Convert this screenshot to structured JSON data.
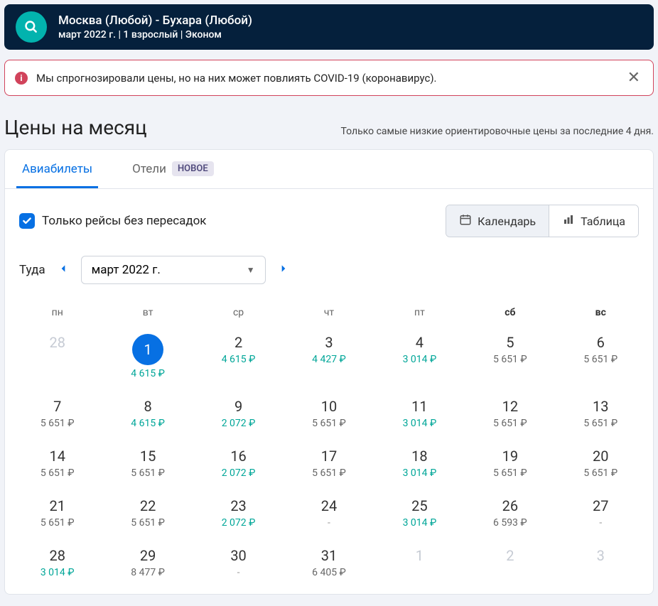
{
  "search": {
    "route": "Москва (Любой) - Бухара (Любой)",
    "details": "март 2022 г. | 1 взрослый | Эконом"
  },
  "alert": {
    "text": "Мы спрогнозировали цены, но на них может повлиять COVID-19 (коронавирус)."
  },
  "title": "Цены на месяц",
  "subtitle": "Только самые низкие ориентировочные цены за последние 4 дня.",
  "tabs": {
    "flights": "Авиабилеты",
    "hotels": "Отели",
    "new_badge": "НОВОЕ"
  },
  "checkbox_label": "Только рейсы без пересадок",
  "view_toggle": {
    "calendar": "Календарь",
    "table": "Таблица"
  },
  "month_nav": {
    "direction": "Туда",
    "selected": "март 2022 г."
  },
  "daynames": [
    "пн",
    "вт",
    "ср",
    "чт",
    "пт",
    "сб",
    "вс"
  ],
  "chart_data": {
    "type": "table",
    "title": "Цены на месяц март 2022",
    "currency": "₽",
    "lowest_highlight_threshold": 5000,
    "cells": [
      {
        "day": "28",
        "price": null,
        "muted": true,
        "selected": false,
        "green": false
      },
      {
        "day": "1",
        "price": "4 615 ₽",
        "muted": false,
        "selected": true,
        "green": true
      },
      {
        "day": "2",
        "price": "4 615 ₽",
        "muted": false,
        "selected": false,
        "green": true
      },
      {
        "day": "3",
        "price": "4 427 ₽",
        "muted": false,
        "selected": false,
        "green": true
      },
      {
        "day": "4",
        "price": "3 014 ₽",
        "muted": false,
        "selected": false,
        "green": true
      },
      {
        "day": "5",
        "price": "5 651 ₽",
        "muted": false,
        "selected": false,
        "green": false
      },
      {
        "day": "6",
        "price": "5 651 ₽",
        "muted": false,
        "selected": false,
        "green": false
      },
      {
        "day": "7",
        "price": "5 651 ₽",
        "muted": false,
        "selected": false,
        "green": false
      },
      {
        "day": "8",
        "price": "4 615 ₽",
        "muted": false,
        "selected": false,
        "green": true
      },
      {
        "day": "9",
        "price": "2 072 ₽",
        "muted": false,
        "selected": false,
        "green": true
      },
      {
        "day": "10",
        "price": "5 651 ₽",
        "muted": false,
        "selected": false,
        "green": false
      },
      {
        "day": "11",
        "price": "3 014 ₽",
        "muted": false,
        "selected": false,
        "green": true
      },
      {
        "day": "12",
        "price": "5 651 ₽",
        "muted": false,
        "selected": false,
        "green": false
      },
      {
        "day": "13",
        "price": "5 651 ₽",
        "muted": false,
        "selected": false,
        "green": false
      },
      {
        "day": "14",
        "price": "5 651 ₽",
        "muted": false,
        "selected": false,
        "green": false
      },
      {
        "day": "15",
        "price": "5 651 ₽",
        "muted": false,
        "selected": false,
        "green": false
      },
      {
        "day": "16",
        "price": "2 072 ₽",
        "muted": false,
        "selected": false,
        "green": true
      },
      {
        "day": "17",
        "price": "5 651 ₽",
        "muted": false,
        "selected": false,
        "green": false
      },
      {
        "day": "18",
        "price": "3 014 ₽",
        "muted": false,
        "selected": false,
        "green": true
      },
      {
        "day": "19",
        "price": "5 651 ₽",
        "muted": false,
        "selected": false,
        "green": false
      },
      {
        "day": "20",
        "price": "5 651 ₽",
        "muted": false,
        "selected": false,
        "green": false
      },
      {
        "day": "21",
        "price": "5 651 ₽",
        "muted": false,
        "selected": false,
        "green": false
      },
      {
        "day": "22",
        "price": "5 651 ₽",
        "muted": false,
        "selected": false,
        "green": false
      },
      {
        "day": "23",
        "price": "2 072 ₽",
        "muted": false,
        "selected": false,
        "green": true
      },
      {
        "day": "24",
        "price": "-",
        "muted": false,
        "selected": false,
        "green": false
      },
      {
        "day": "25",
        "price": "3 014 ₽",
        "muted": false,
        "selected": false,
        "green": true
      },
      {
        "day": "26",
        "price": "6 593 ₽",
        "muted": false,
        "selected": false,
        "green": false
      },
      {
        "day": "27",
        "price": "-",
        "muted": false,
        "selected": false,
        "green": false
      },
      {
        "day": "28",
        "price": "3 014 ₽",
        "muted": false,
        "selected": false,
        "green": true
      },
      {
        "day": "29",
        "price": "8 477 ₽",
        "muted": false,
        "selected": false,
        "green": false
      },
      {
        "day": "30",
        "price": "-",
        "muted": false,
        "selected": false,
        "green": false
      },
      {
        "day": "31",
        "price": "6 405 ₽",
        "muted": false,
        "selected": false,
        "green": false
      },
      {
        "day": "1",
        "price": null,
        "muted": true,
        "selected": false,
        "green": false
      },
      {
        "day": "2",
        "price": null,
        "muted": true,
        "selected": false,
        "green": false
      },
      {
        "day": "3",
        "price": null,
        "muted": true,
        "selected": false,
        "green": false
      }
    ]
  }
}
